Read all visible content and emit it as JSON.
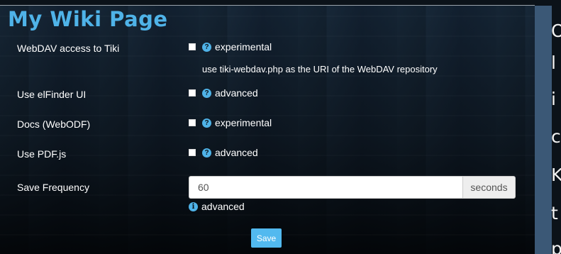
{
  "page": {
    "title": "My Wiki Page"
  },
  "settings": [
    {
      "label": "WebDAV access to Tiki",
      "help": "?",
      "tag": "experimental",
      "note": "use tiki-webdav.php as the URI of the WebDAV repository"
    },
    {
      "label": "Use elFinder UI",
      "help": "?",
      "tag": "advanced"
    },
    {
      "label": "Docs (WebODF)",
      "help": "?",
      "tag": "experimental"
    },
    {
      "label": "Use PDF.js",
      "help": "?",
      "tag": "advanced"
    }
  ],
  "save_frequency": {
    "label": "Save Frequency",
    "value": "60",
    "unit": "seconds",
    "info": "i",
    "tag": "advanced"
  },
  "actions": {
    "save_label": "Save"
  },
  "side_text": [
    "O",
    "l",
    "i",
    "c",
    "K",
    "t",
    "p"
  ]
}
